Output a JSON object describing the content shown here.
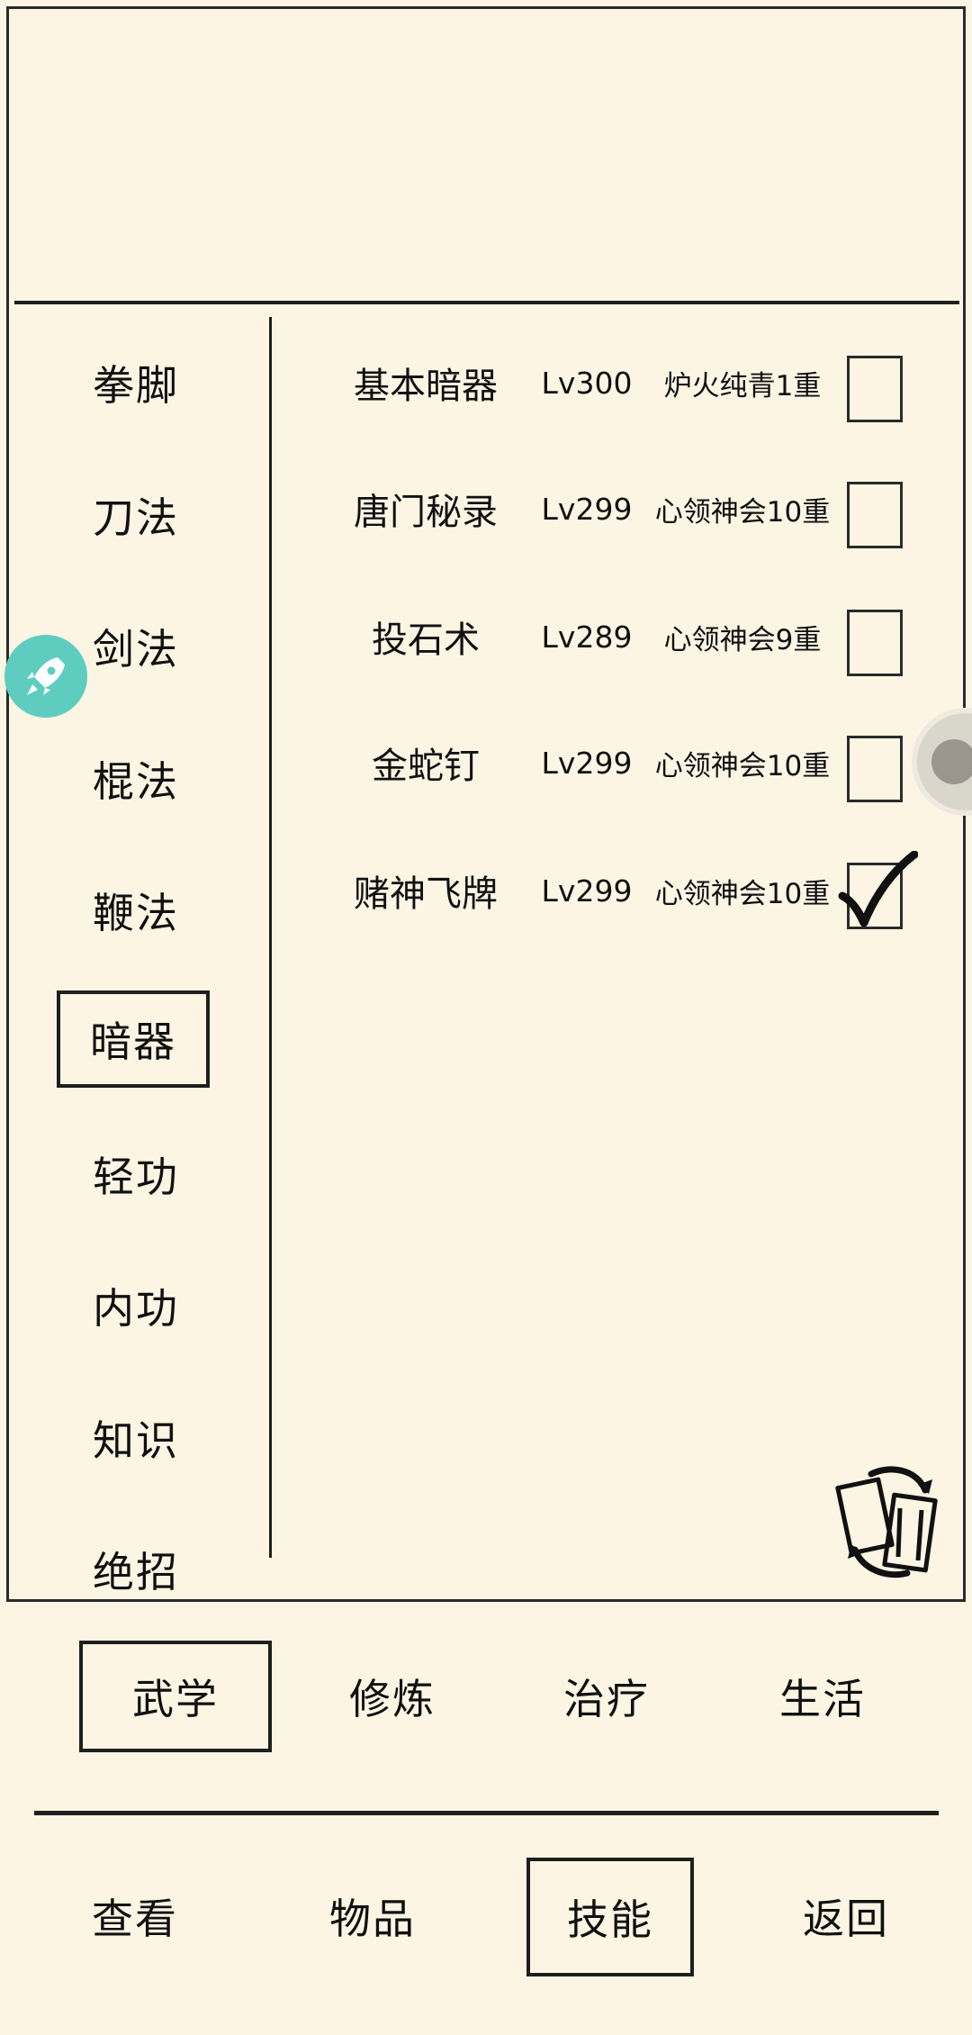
{
  "sidebar": {
    "categories": [
      {
        "label": "拳脚"
      },
      {
        "label": "刀法"
      },
      {
        "label": "剑法"
      },
      {
        "label": "棍法"
      },
      {
        "label": "鞭法"
      },
      {
        "label": "暗器",
        "selected": true
      },
      {
        "label": "轻功"
      },
      {
        "label": "内功"
      },
      {
        "label": "知识"
      },
      {
        "label": "绝招"
      }
    ]
  },
  "skills": [
    {
      "name": "基本暗器",
      "level": "Lv300",
      "rank": "炉火纯青1重",
      "checked": false
    },
    {
      "name": "唐门秘录",
      "level": "Lv299",
      "rank": "心领神会10重",
      "checked": false
    },
    {
      "name": "投石术",
      "level": "Lv289",
      "rank": "心领神会9重",
      "checked": false
    },
    {
      "name": "金蛇钉",
      "level": "Lv299",
      "rank": "心领神会10重",
      "checked": false
    },
    {
      "name": "赌神飞牌",
      "level": "Lv299",
      "rank": "心领神会10重",
      "checked": true
    }
  ],
  "sub_tabs": [
    {
      "label": "武学",
      "selected": true
    },
    {
      "label": "修炼"
    },
    {
      "label": "治疗"
    },
    {
      "label": "生活"
    }
  ],
  "bottom_nav": [
    {
      "label": "查看"
    },
    {
      "label": "物品"
    },
    {
      "label": "技能",
      "selected": true
    },
    {
      "label": "返回"
    }
  ],
  "icons": {
    "fab": "rocket-icon",
    "refresh": "refresh-cards-icon",
    "check": "checkmark-icon"
  },
  "colors": {
    "background": "#fcf5e4",
    "ink": "#1f1f1f",
    "fab": "#5ecdbf"
  }
}
